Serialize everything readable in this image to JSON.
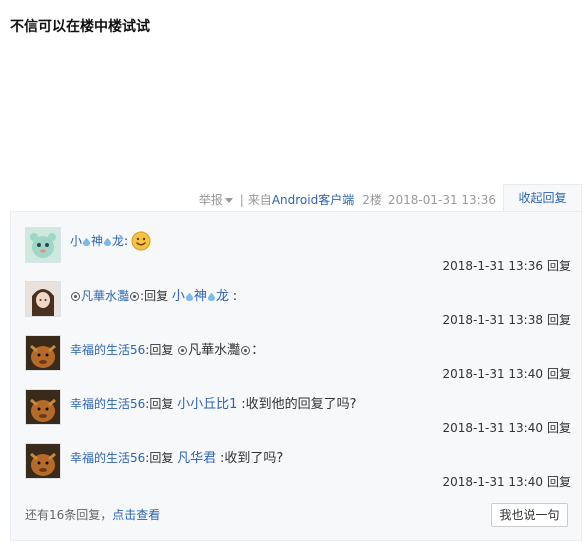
{
  "post": {
    "text": "不信可以在楼中楼试试"
  },
  "tail": {
    "report": "举报",
    "sep": "|",
    "from_prefix": "来自",
    "client": "Android客户端",
    "floor": "2楼",
    "time": "2018-01-31 13:36",
    "collapse": "收起回复"
  },
  "replies": [
    {
      "user": "小神龙",
      "user_parts": [
        "小",
        "神",
        "龙"
      ],
      "sep": ":",
      "reply_word": "",
      "target": "",
      "content": "",
      "emoji": "smile-emoji",
      "time": "2018-1-31 13:36",
      "reply_btn": "回复"
    },
    {
      "user": "凡華水灩",
      "sep": ":",
      "reply_word": "回复",
      "target_parts": [
        "小",
        "神",
        "龙"
      ],
      "content": ":",
      "time": "2018-1-31 13:38",
      "reply_btn": "回复"
    },
    {
      "user": "幸福的生活56",
      "sep": ":",
      "reply_word": "回复",
      "target_name": "凡華水灩",
      "content": "：",
      "time": "2018-1-31 13:40",
      "reply_btn": "回复"
    },
    {
      "user": "幸福的生活56",
      "sep": ":",
      "reply_word": "回复",
      "target": "小小丘比1",
      "content": ":收到他的回复了吗?",
      "time": "2018-1-31 13:40",
      "reply_btn": "回复"
    },
    {
      "user": "幸福的生活56",
      "sep": ":",
      "reply_word": "回复",
      "target": "凡华君",
      "content": ":收到了吗?",
      "time": "2018-1-31 13:40",
      "reply_btn": "回复"
    }
  ],
  "footer": {
    "more_prefix": "还有16条回复，",
    "more_link": "点击查看",
    "say_button": "我也说一句"
  },
  "colors": {
    "link": "#2d64b3",
    "panel_bg": "#f7f8fa",
    "panel_border": "#e8ebf0"
  }
}
